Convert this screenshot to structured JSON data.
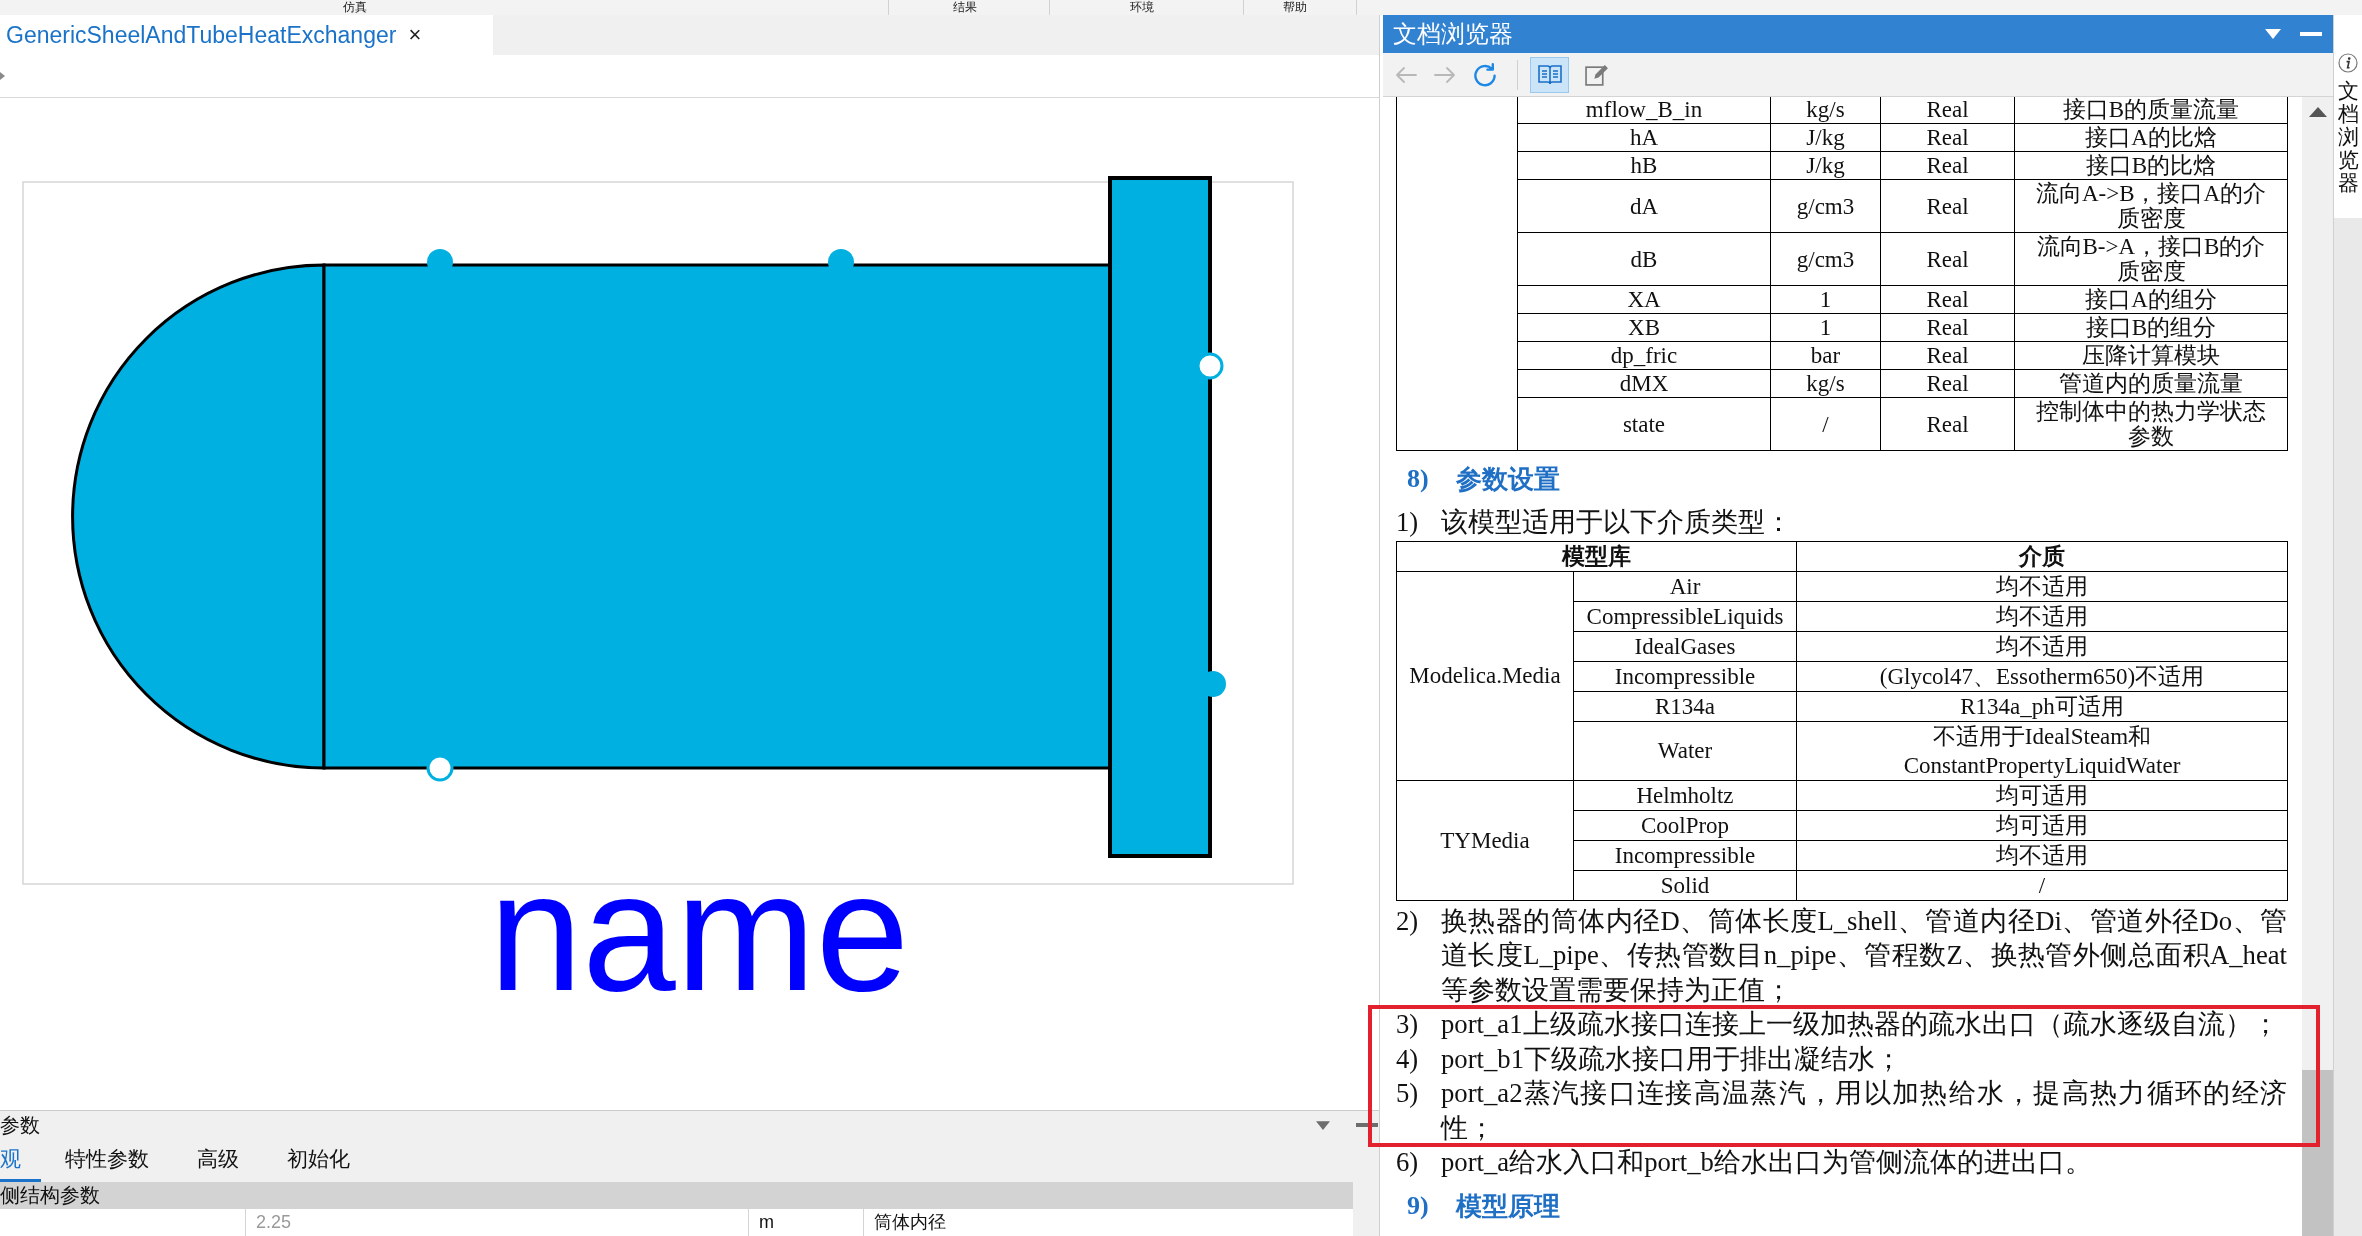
{
  "menu_bar": {
    "items": [
      {
        "label": "仿真"
      },
      {
        "label": "结果"
      },
      {
        "label": "环境"
      },
      {
        "label": "帮助"
      }
    ]
  },
  "editor": {
    "tabs": [
      {
        "label": "GenericSheelAndTubeHeatExchanger",
        "close": "×",
        "selected": true
      }
    ],
    "diagram": {
      "name_label": "name",
      "ports": [
        {
          "filled": true
        },
        {
          "filled": true
        },
        {
          "filled": false
        },
        {
          "filled": true
        },
        {
          "filled": false
        }
      ]
    }
  },
  "parameters_panel": {
    "title": "参数",
    "tabs": [
      {
        "label": "观",
        "selected": true
      },
      {
        "label": "特性参数",
        "selected": false
      },
      {
        "label": "高级",
        "selected": false
      },
      {
        "label": "初始化",
        "selected": false
      }
    ],
    "group": "侧结构参数",
    "rows": [
      {
        "value": "2.25",
        "default": true,
        "unit": "m",
        "description": "筒体内径"
      }
    ]
  },
  "doc_browser": {
    "title": "文档浏览器",
    "nav_buttons": [
      {
        "kind": "back",
        "disabled": true
      },
      {
        "kind": "forward",
        "disabled": true
      },
      {
        "kind": "refresh",
        "disabled": false
      }
    ],
    "mode_buttons": [
      {
        "kind": "view",
        "selected": true
      },
      {
        "kind": "edit",
        "selected": false
      }
    ],
    "variables_table": {
      "rows": [
        {
          "name": "mflow_B_in",
          "unit": "kg/s",
          "type": "Real",
          "description": "接口B的质量流量"
        },
        {
          "name": "hA",
          "unit": "J/kg",
          "type": "Real",
          "description": "接口A的比焓"
        },
        {
          "name": "hB",
          "unit": "J/kg",
          "type": "Real",
          "description": "接口B的比焓"
        },
        {
          "name": "dA",
          "unit": "g/cm3",
          "type": "Real",
          "description": "流向A->B，接口A的介质密度"
        },
        {
          "name": "dB",
          "unit": "g/cm3",
          "type": "Real",
          "description": "流向B->A，接口B的介质密度"
        },
        {
          "name": "XA",
          "unit": "1",
          "type": "Real",
          "description": "接口A的组分"
        },
        {
          "name": "XB",
          "unit": "1",
          "type": "Real",
          "description": "接口B的组分"
        },
        {
          "name": "dp_fric",
          "unit": "bar",
          "type": "Real",
          "description": "压降计算模块"
        },
        {
          "name": "dMX",
          "unit": "kg/s",
          "type": "Real",
          "description": "管道内的质量流量"
        },
        {
          "name": "state",
          "unit": "/",
          "type": "Real",
          "description": "控制体中的热力学状态参数"
        }
      ]
    },
    "section_8": {
      "number": "8)",
      "title": "参数设置"
    },
    "intro": {
      "number": "1)",
      "text": "该模型适用于以下介质类型："
    },
    "media_table": {
      "columns": [
        "模型库",
        "介质"
      ],
      "groups": [
        {
          "library": "Modelica.Media",
          "rows": [
            {
              "medium": "Air",
              "applicability": "均不适用"
            },
            {
              "medium": "CompressibleLiquids",
              "applicability": "均不适用"
            },
            {
              "medium": "IdealGases",
              "applicability": "均不适用"
            },
            {
              "medium": "Incompressible",
              "applicability": "(Glycol47、Essotherm650)不适用"
            },
            {
              "medium": "R134a",
              "applicability": "R134a_ph可适用"
            },
            {
              "medium": "Water",
              "applicability": "不适用于IdealSteam和ConstantPropertyLiquidWater"
            }
          ]
        },
        {
          "library": "TYMedia",
          "rows": [
            {
              "medium": "Helmholtz",
              "applicability": "均可适用"
            },
            {
              "medium": "CoolProp",
              "applicability": "均可适用"
            },
            {
              "medium": "Incompressible",
              "applicability": "均不适用"
            },
            {
              "medium": "Solid",
              "applicability": "/"
            }
          ]
        }
      ]
    },
    "notes": [
      {
        "number": "2)",
        "text": "换热器的筒体内径D、筒体长度L_shell、管道内径Di、管道外径Do、管道长度L_pipe、传热管数目n_pipe、管程数Z、换热管外侧总面积A_heat等参数设置需要保持为正值；",
        "highlighted": false
      },
      {
        "number": "3)",
        "text": "port_a1上级疏水接口连接上一级加热器的疏水出口（疏水逐级自流）；",
        "highlighted": true
      },
      {
        "number": "4)",
        "text": "port_b1下级疏水接口用于排出凝结水；",
        "highlighted": true
      },
      {
        "number": "5)",
        "text": "port_a2蒸汽接口连接高温蒸汽，用以加热给水，提高热力循环的经济性；",
        "highlighted": true
      },
      {
        "number": "6)",
        "text": "port_a给水入口和port_b给水出口为管侧流体的进出口。",
        "highlighted": false
      }
    ],
    "section_9": {
      "number": "9)",
      "title": "模型原理"
    }
  },
  "side_tabs": [
    {
      "label": "文档浏览器"
    }
  ]
}
